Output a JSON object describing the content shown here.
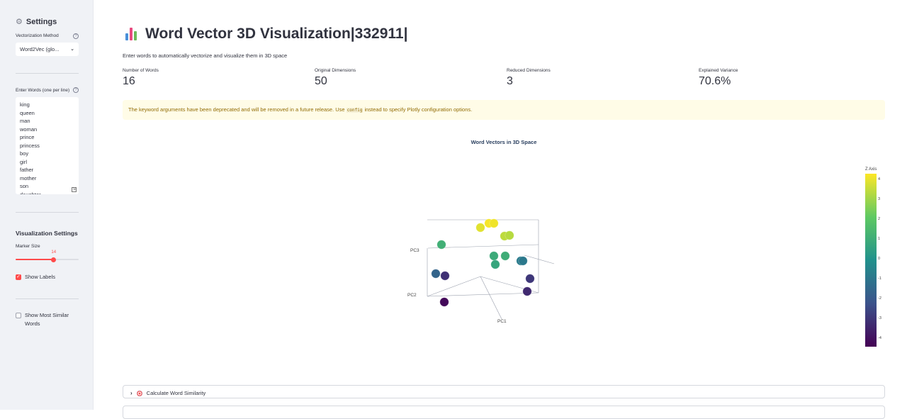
{
  "sidebar": {
    "header": "Settings",
    "vectorization_label": "Vectorization Method",
    "vectorization_value": "Word2Vec (glo...",
    "words_label": "Enter Words (one per line)",
    "words": [
      "king",
      "queen",
      "man",
      "woman",
      "prince",
      "princess",
      "boy",
      "girl",
      "father",
      "mother",
      "son",
      "daughter"
    ],
    "vis_settings_title": "Visualization Settings",
    "marker_size_label": "Marker Size",
    "marker_size_value": "14",
    "marker_size_fraction": 0.6,
    "show_labels_label": "Show Labels",
    "show_labels_checked": true,
    "show_similar_label": "Show Most Similar Words",
    "show_similar_checked": false
  },
  "main": {
    "title": "Word Vector 3D Visualization|332911|",
    "subtitle": "Enter words to automatically vectorize and visualize them in 3D space",
    "metrics": [
      {
        "label": "Number of Words",
        "value": "16"
      },
      {
        "label": "Original Dimensions",
        "value": "50"
      },
      {
        "label": "Reduced Dimensions",
        "value": "3"
      },
      {
        "label": "Explained Variance",
        "value": "70.6%"
      }
    ],
    "warning_before": "The keyword arguments have been deprecated and will be removed in a future release. Use ",
    "warning_code": "config",
    "warning_after": " instead to specify Plotly configuration options.",
    "expander_label": "Calculate Word Similarity"
  },
  "chart_data": {
    "type": "scatter",
    "title": "Word Vectors in 3D Space",
    "axis_titles": {
      "x": "PC1",
      "y": "PC2",
      "z": "PC3"
    },
    "colorbar_title": "Z Axis",
    "colorbar_ticks": [
      "4",
      "3",
      "2",
      "1",
      "0",
      "-1",
      "-2",
      "-3",
      "-4"
    ],
    "colorscale": [
      "#440154",
      "#3b528b",
      "#21918c",
      "#5ec962",
      "#fde725"
    ],
    "points": [
      {
        "z": 4.4
      },
      {
        "z": 4.3
      },
      {
        "z": 4.1
      },
      {
        "z": 3.6
      },
      {
        "z": 3.5
      },
      {
        "z": 1.2
      },
      {
        "z": 1.0
      },
      {
        "z": 1.1
      },
      {
        "z": 0.8
      },
      {
        "z": -0.8
      },
      {
        "z": -0.9
      },
      {
        "z": -1.6
      },
      {
        "z": -3.2
      },
      {
        "z": -3.0
      },
      {
        "z": -3.4
      },
      {
        "z": -4.3
      }
    ]
  },
  "colors": {
    "accent": "#ff4b4b",
    "warning_bg": "#fffce7",
    "warning_text": "#926c05"
  }
}
